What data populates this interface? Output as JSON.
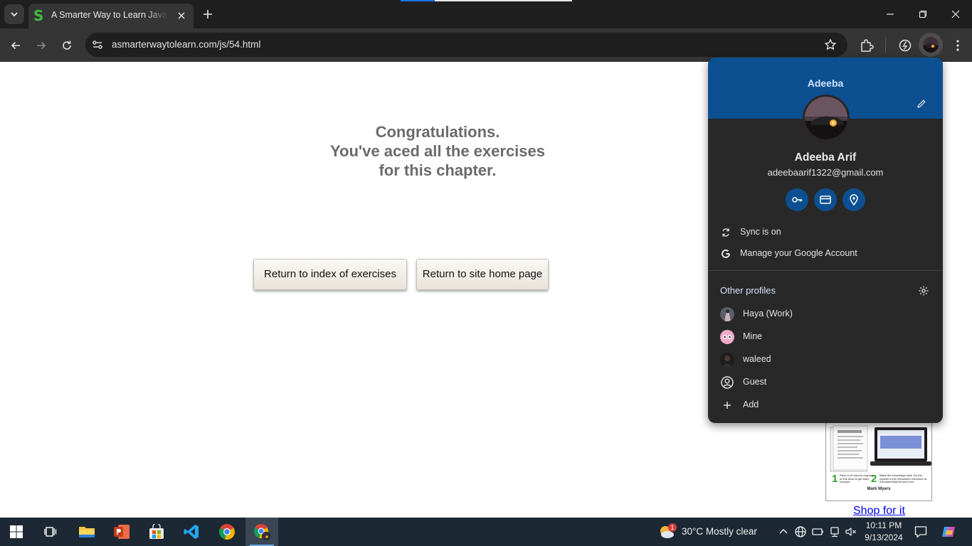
{
  "browser": {
    "tab": {
      "title": "A Smarter Way to Learn JavaScript",
      "favicon": "S"
    },
    "url": "asmarterwaytolearn.com/js/54.html"
  },
  "page": {
    "congrats_lines": [
      "Congratulations.",
      "You've aced all the exercises",
      "for this chapter."
    ],
    "buttons": {
      "index": "Return to index of exercises",
      "home": "Return to site home page"
    },
    "ad": {
      "step1_num": "1",
      "step1_text": "Read a 10-minute chapter of this book to get each concept.",
      "step2_num": "2",
      "step2_text": "Make the knowledge stick. Do the chapter's free interactive exercises at ASmarterWayToLearn.com.",
      "author": "Mark Myers"
    },
    "shop_link": "Shop for it"
  },
  "profile_menu": {
    "banner_name": "Adeeba",
    "full_name": "Adeeba Arif",
    "email": "adeebaarif1322@gmail.com",
    "sync": "Sync is on",
    "manage": "Manage your Google Account",
    "other_profiles": "Other profiles",
    "profiles": [
      "Haya (Work)",
      "Mine",
      "waleed",
      "Guest"
    ],
    "add": "Add"
  },
  "taskbar": {
    "weather_badge": "1",
    "weather": "30°C  Mostly clear",
    "time": "10:11 PM",
    "date": "9/13/2024"
  },
  "colors": {
    "banner": "#0d5091",
    "menu_bg": "#282828",
    "accent_green": "#3ebd3e",
    "link": "#0000ee"
  }
}
